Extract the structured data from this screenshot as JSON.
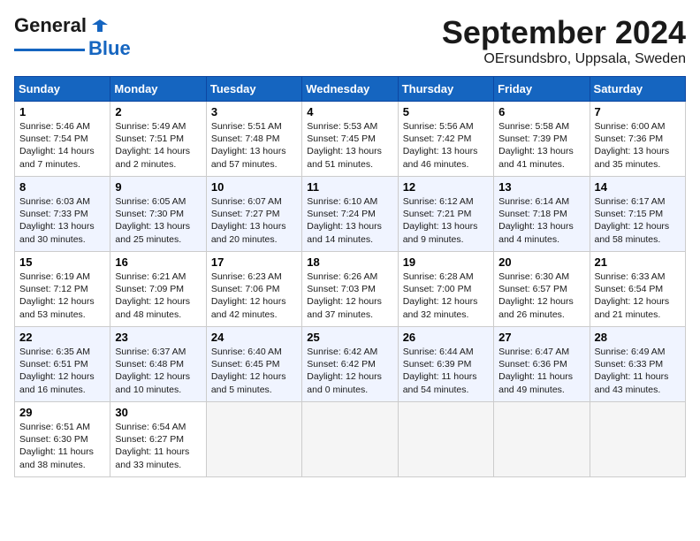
{
  "header": {
    "logo_general": "General",
    "logo_blue": "Blue",
    "month_title": "September 2024",
    "location": "OErsundsbro, Uppsala, Sweden"
  },
  "days_of_week": [
    "Sunday",
    "Monday",
    "Tuesday",
    "Wednesday",
    "Thursday",
    "Friday",
    "Saturday"
  ],
  "weeks": [
    [
      {
        "day": "1",
        "line1": "Sunrise: 5:46 AM",
        "line2": "Sunset: 7:54 PM",
        "line3": "Daylight: 14 hours",
        "line4": "and 7 minutes."
      },
      {
        "day": "2",
        "line1": "Sunrise: 5:49 AM",
        "line2": "Sunset: 7:51 PM",
        "line3": "Daylight: 14 hours",
        "line4": "and 2 minutes."
      },
      {
        "day": "3",
        "line1": "Sunrise: 5:51 AM",
        "line2": "Sunset: 7:48 PM",
        "line3": "Daylight: 13 hours",
        "line4": "and 57 minutes."
      },
      {
        "day": "4",
        "line1": "Sunrise: 5:53 AM",
        "line2": "Sunset: 7:45 PM",
        "line3": "Daylight: 13 hours",
        "line4": "and 51 minutes."
      },
      {
        "day": "5",
        "line1": "Sunrise: 5:56 AM",
        "line2": "Sunset: 7:42 PM",
        "line3": "Daylight: 13 hours",
        "line4": "and 46 minutes."
      },
      {
        "day": "6",
        "line1": "Sunrise: 5:58 AM",
        "line2": "Sunset: 7:39 PM",
        "line3": "Daylight: 13 hours",
        "line4": "and 41 minutes."
      },
      {
        "day": "7",
        "line1": "Sunrise: 6:00 AM",
        "line2": "Sunset: 7:36 PM",
        "line3": "Daylight: 13 hours",
        "line4": "and 35 minutes."
      }
    ],
    [
      {
        "day": "8",
        "line1": "Sunrise: 6:03 AM",
        "line2": "Sunset: 7:33 PM",
        "line3": "Daylight: 13 hours",
        "line4": "and 30 minutes."
      },
      {
        "day": "9",
        "line1": "Sunrise: 6:05 AM",
        "line2": "Sunset: 7:30 PM",
        "line3": "Daylight: 13 hours",
        "line4": "and 25 minutes."
      },
      {
        "day": "10",
        "line1": "Sunrise: 6:07 AM",
        "line2": "Sunset: 7:27 PM",
        "line3": "Daylight: 13 hours",
        "line4": "and 20 minutes."
      },
      {
        "day": "11",
        "line1": "Sunrise: 6:10 AM",
        "line2": "Sunset: 7:24 PM",
        "line3": "Daylight: 13 hours",
        "line4": "and 14 minutes."
      },
      {
        "day": "12",
        "line1": "Sunrise: 6:12 AM",
        "line2": "Sunset: 7:21 PM",
        "line3": "Daylight: 13 hours",
        "line4": "and 9 minutes."
      },
      {
        "day": "13",
        "line1": "Sunrise: 6:14 AM",
        "line2": "Sunset: 7:18 PM",
        "line3": "Daylight: 13 hours",
        "line4": "and 4 minutes."
      },
      {
        "day": "14",
        "line1": "Sunrise: 6:17 AM",
        "line2": "Sunset: 7:15 PM",
        "line3": "Daylight: 12 hours",
        "line4": "and 58 minutes."
      }
    ],
    [
      {
        "day": "15",
        "line1": "Sunrise: 6:19 AM",
        "line2": "Sunset: 7:12 PM",
        "line3": "Daylight: 12 hours",
        "line4": "and 53 minutes."
      },
      {
        "day": "16",
        "line1": "Sunrise: 6:21 AM",
        "line2": "Sunset: 7:09 PM",
        "line3": "Daylight: 12 hours",
        "line4": "and 48 minutes."
      },
      {
        "day": "17",
        "line1": "Sunrise: 6:23 AM",
        "line2": "Sunset: 7:06 PM",
        "line3": "Daylight: 12 hours",
        "line4": "and 42 minutes."
      },
      {
        "day": "18",
        "line1": "Sunrise: 6:26 AM",
        "line2": "Sunset: 7:03 PM",
        "line3": "Daylight: 12 hours",
        "line4": "and 37 minutes."
      },
      {
        "day": "19",
        "line1": "Sunrise: 6:28 AM",
        "line2": "Sunset: 7:00 PM",
        "line3": "Daylight: 12 hours",
        "line4": "and 32 minutes."
      },
      {
        "day": "20",
        "line1": "Sunrise: 6:30 AM",
        "line2": "Sunset: 6:57 PM",
        "line3": "Daylight: 12 hours",
        "line4": "and 26 minutes."
      },
      {
        "day": "21",
        "line1": "Sunrise: 6:33 AM",
        "line2": "Sunset: 6:54 PM",
        "line3": "Daylight: 12 hours",
        "line4": "and 21 minutes."
      }
    ],
    [
      {
        "day": "22",
        "line1": "Sunrise: 6:35 AM",
        "line2": "Sunset: 6:51 PM",
        "line3": "Daylight: 12 hours",
        "line4": "and 16 minutes."
      },
      {
        "day": "23",
        "line1": "Sunrise: 6:37 AM",
        "line2": "Sunset: 6:48 PM",
        "line3": "Daylight: 12 hours",
        "line4": "and 10 minutes."
      },
      {
        "day": "24",
        "line1": "Sunrise: 6:40 AM",
        "line2": "Sunset: 6:45 PM",
        "line3": "Daylight: 12 hours",
        "line4": "and 5 minutes."
      },
      {
        "day": "25",
        "line1": "Sunrise: 6:42 AM",
        "line2": "Sunset: 6:42 PM",
        "line3": "Daylight: 12 hours",
        "line4": "and 0 minutes."
      },
      {
        "day": "26",
        "line1": "Sunrise: 6:44 AM",
        "line2": "Sunset: 6:39 PM",
        "line3": "Daylight: 11 hours",
        "line4": "and 54 minutes."
      },
      {
        "day": "27",
        "line1": "Sunrise: 6:47 AM",
        "line2": "Sunset: 6:36 PM",
        "line3": "Daylight: 11 hours",
        "line4": "and 49 minutes."
      },
      {
        "day": "28",
        "line1": "Sunrise: 6:49 AM",
        "line2": "Sunset: 6:33 PM",
        "line3": "Daylight: 11 hours",
        "line4": "and 43 minutes."
      }
    ],
    [
      {
        "day": "29",
        "line1": "Sunrise: 6:51 AM",
        "line2": "Sunset: 6:30 PM",
        "line3": "Daylight: 11 hours",
        "line4": "and 38 minutes."
      },
      {
        "day": "30",
        "line1": "Sunrise: 6:54 AM",
        "line2": "Sunset: 6:27 PM",
        "line3": "Daylight: 11 hours",
        "line4": "and 33 minutes."
      },
      {
        "day": "",
        "line1": "",
        "line2": "",
        "line3": "",
        "line4": ""
      },
      {
        "day": "",
        "line1": "",
        "line2": "",
        "line3": "",
        "line4": ""
      },
      {
        "day": "",
        "line1": "",
        "line2": "",
        "line3": "",
        "line4": ""
      },
      {
        "day": "",
        "line1": "",
        "line2": "",
        "line3": "",
        "line4": ""
      },
      {
        "day": "",
        "line1": "",
        "line2": "",
        "line3": "",
        "line4": ""
      }
    ]
  ]
}
